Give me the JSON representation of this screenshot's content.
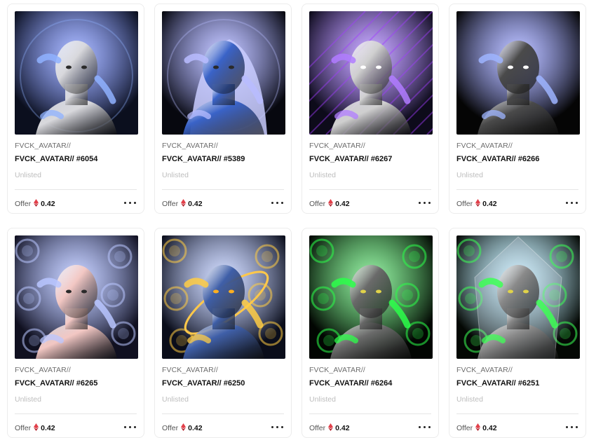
{
  "items": [
    {
      "collection": "FVCK_AVATAR//",
      "title": "FVCK_AVATAR// #6054",
      "status": "Unlisted",
      "offer_label": "Offer",
      "price": "0.42",
      "theme": {
        "bg": "#0b0f1e",
        "face": "#d8d8dc",
        "accent": "#8fb2ff",
        "glow": "#4c6cff"
      },
      "icon": "eth-icon"
    },
    {
      "collection": "FVCK_AVATAR//",
      "title": "FVCK_AVATAR// #5389",
      "status": "Unlisted",
      "offer_label": "Offer",
      "price": "0.42",
      "theme": {
        "bg": "#07080f",
        "face": "#3a63c8",
        "accent": "#b8bcff",
        "glow": "#7e86ff"
      },
      "icon": "eth-icon"
    },
    {
      "collection": "FVCK_AVATAR//",
      "title": "FVCK_AVATAR// #6267",
      "status": "Unlisted",
      "offer_label": "Offer",
      "price": "0.42",
      "theme": {
        "bg": "#0d0b1a",
        "face": "#cfcfcf",
        "accent": "#b07cff",
        "glow": "#8a4dff"
      },
      "icon": "eth-icon"
    },
    {
      "collection": "FVCK_AVATAR//",
      "title": "FVCK_AVATAR// #6266",
      "status": "Unlisted",
      "offer_label": "Offer",
      "price": "0.42",
      "theme": {
        "bg": "#050505",
        "face": "#4a4a4a",
        "accent": "#9eb4ff",
        "glow": "#6e7bff"
      },
      "icon": "eth-icon"
    },
    {
      "collection": "FVCK_AVATAR//",
      "title": "FVCK_AVATAR// #6265",
      "status": "Unlisted",
      "offer_label": "Offer",
      "price": "0.42",
      "theme": {
        "bg": "#101020",
        "face": "#f2c7c3",
        "accent": "#b9c6ff",
        "glow": "#8aa0ff"
      },
      "icon": "eth-icon"
    },
    {
      "collection": "FVCK_AVATAR//",
      "title": "FVCK_AVATAR// #6250",
      "status": "Unlisted",
      "offer_label": "Offer",
      "price": "0.42",
      "theme": {
        "bg": "#0a0d1a",
        "face": "#3f5fa8",
        "accent": "#ffcc44",
        "glow": "#a0b6ff"
      },
      "icon": "eth-icon"
    },
    {
      "collection": "FVCK_AVATAR//",
      "title": "FVCK_AVATAR// #6264",
      "status": "Unlisted",
      "offer_label": "Offer",
      "price": "0.42",
      "theme": {
        "bg": "#020602",
        "face": "#6a6a6a",
        "accent": "#2cff4a",
        "glow": "#1fd43a"
      },
      "icon": "eth-icon"
    },
    {
      "collection": "FVCK_AVATAR//",
      "title": "FVCK_AVATAR// #6251",
      "status": "Unlisted",
      "offer_label": "Offer",
      "price": "0.42",
      "theme": {
        "bg": "#040804",
        "face": "#8a8a8a",
        "accent": "#3dff55",
        "glow": "#9ae6ff"
      },
      "icon": "eth-icon"
    }
  ]
}
